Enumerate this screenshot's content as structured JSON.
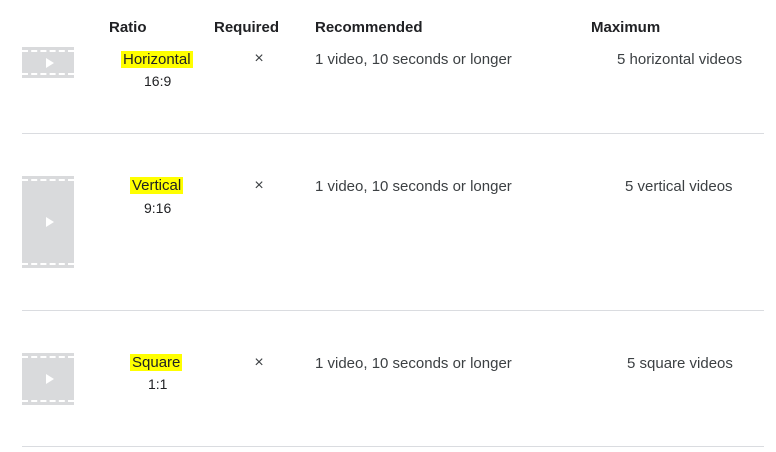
{
  "header": {
    "ratio": "Ratio",
    "required": "Required",
    "recommended": "Recommended",
    "maximum": "Maximum"
  },
  "rows": [
    {
      "ratio_name": "Horizontal",
      "ratio_value": "16:9",
      "required_mark": "×",
      "recommended": "1 video, 10 seconds or longer",
      "maximum": "5 horizontal videos"
    },
    {
      "ratio_name": "Vertical",
      "ratio_value": "9:16",
      "required_mark": "×",
      "recommended": "1 video, 10 seconds or longer",
      "maximum": "5 vertical videos"
    },
    {
      "ratio_name": "Square",
      "ratio_value": "1:1",
      "required_mark": "×",
      "recommended": "1 video, 10 seconds or longer",
      "maximum": "5 square videos"
    }
  ],
  "colors": {
    "highlight": "#ffff00",
    "thumbnail": "#d9dadc",
    "divider": "#dadce0"
  },
  "icons": [
    "video-thumbnail-icon",
    "play-icon",
    "close-x-icon"
  ]
}
